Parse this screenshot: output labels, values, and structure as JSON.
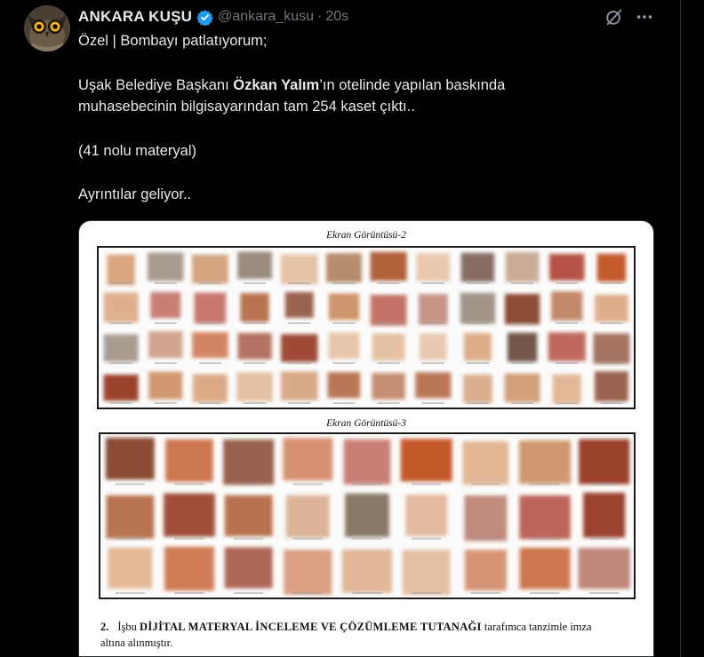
{
  "tweet": {
    "display_name": "ANKARA KUŞU",
    "handle": "@ankara_kusu",
    "separator": "·",
    "time": "20s",
    "lines": {
      "l1": "Özel | Bombayı patlatıyorum;",
      "l2_pre": "Uşak Belediye Başkanı ",
      "l2_bold": "Özkan Yalım",
      "l2_post": "’ın otelinde yapılan baskında",
      "l3": "muhasebecinin bilgisayarından tam 254 kaset çıktı..",
      "l4": "(41 nolu materyal)",
      "l5": "Ayrıntılar geliyor.."
    }
  },
  "media": {
    "caption_1": "Ekran Görüntüsü-2",
    "caption_2": "Ekran Görüntüsü-3",
    "doc_number": "2.",
    "doc_pre": "İşbu",
    "doc_bold": "DİJİTAL MATERYAL İNCELEME VE ÇÖZÜMLEME TUTANAĞI",
    "doc_post": "tarafımca tanzimle imza",
    "doc_line2": "altına alınmıştır.",
    "grid_1": {
      "rows": 4,
      "cols": 12
    },
    "grid_2": {
      "rows": 3,
      "cols": 9
    },
    "thumb_palette": [
      "#b0623a",
      "#8a4a30",
      "#c98a5c",
      "#6e5a4a",
      "#d9a27a",
      "#9a3f2a",
      "#c45a2c",
      "#7d6b58",
      "#a8754f",
      "#5c3a2c",
      "#e0b08a",
      "#b34a3a"
    ]
  }
}
